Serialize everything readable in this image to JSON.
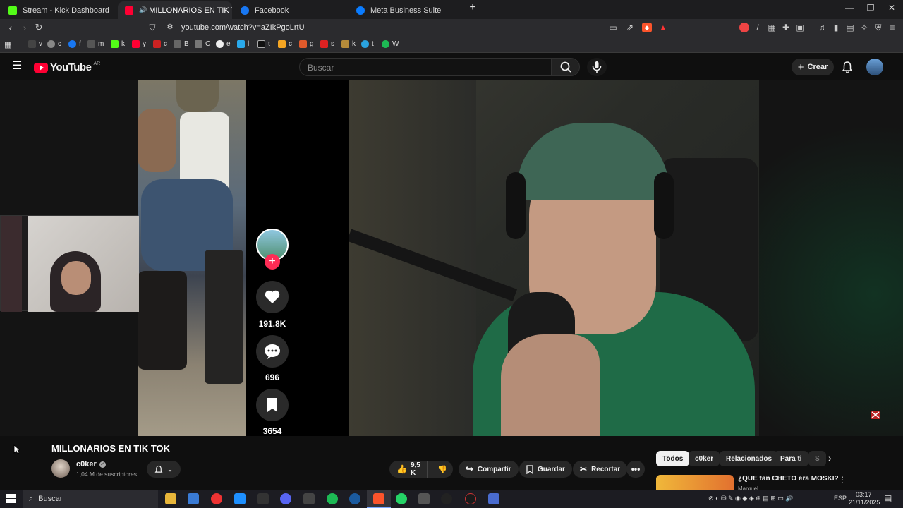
{
  "browser": {
    "tabs": [
      {
        "label": "Stream - Kick Dashboard"
      },
      {
        "label": "MILLONARIOS EN TIK TOK - Y"
      },
      {
        "label": "Facebook"
      },
      {
        "label": "Meta Business Suite"
      }
    ],
    "url": "youtube.com/watch?v=aZIkPgoLrtU",
    "bookmarks": [
      "v",
      "c",
      "f",
      "m",
      "k",
      "y",
      "c",
      "B",
      "C",
      "e",
      "l",
      "t",
      "c",
      "g",
      "s",
      "k",
      "t",
      "W"
    ]
  },
  "youtube": {
    "logo_text": "YouTube",
    "region": "AR",
    "search_placeholder": "Buscar",
    "create_label": "Crear"
  },
  "video_overlay": {
    "likes": "191.8K",
    "comments": "696",
    "saves": "3654"
  },
  "video": {
    "title": "MILLONARIOS EN TIK TOK",
    "channel_name": "c0ker",
    "subscribers": "1,04 M de suscriptores",
    "like_count": "9,5 K",
    "share_label": "Compartir",
    "save_label": "Guardar",
    "clip_label": "Recortar"
  },
  "related_chips": [
    "Todos",
    "c0ker",
    "Relacionados",
    "Para ti",
    "S"
  ],
  "related_first_title": "¿QUE tan CHETO era MOSKI?",
  "related_first_channel": "Marquel",
  "taskbar": {
    "search_placeholder": "Buscar",
    "language": "ESP",
    "time": "03:17",
    "date": "21/11/2025"
  }
}
